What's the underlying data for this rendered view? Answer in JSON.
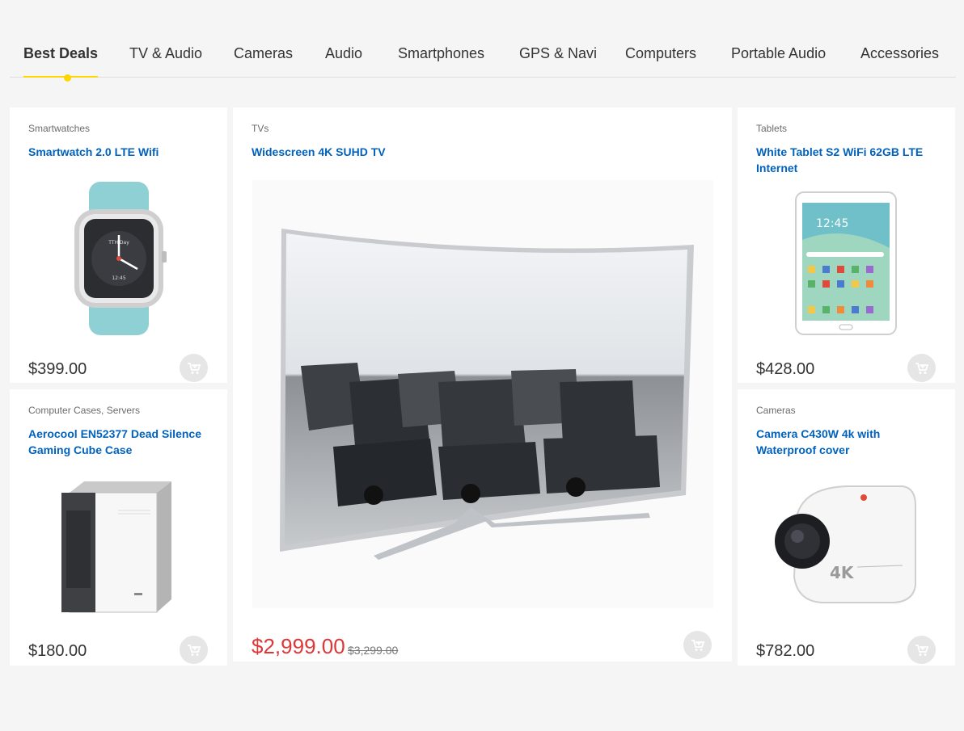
{
  "tabs": [
    "Best Deals",
    "TV & Audio",
    "Cameras",
    "Audio",
    "Smartphones",
    "GPS & Navi",
    "Computers",
    "Portable Audio",
    "Accessories"
  ],
  "active_tab": "Best Deals",
  "colors": {
    "accent": "#fed700",
    "title": "#0062bd",
    "sale": "#df3737",
    "cart_bg": "#e6e6e6"
  },
  "products": {
    "smartwatch": {
      "category": "Smartwatches",
      "title": "Smartwatch 2.0 LTE Wifi",
      "price": "$399.00",
      "icon": "add-to-cart-icon"
    },
    "tv": {
      "category": "TVs",
      "title": "Widescreen 4K SUHD TV",
      "price": "$2,999.00",
      "old_price": "$3,299.00",
      "icon": "add-to-cart-icon"
    },
    "tablet": {
      "category": "Tablets",
      "title": "White Tablet S2 WiFi 62GB LTE Internet",
      "price": "$428.00",
      "icon": "add-to-cart-icon"
    },
    "case": {
      "category": "Computer Cases, Servers",
      "title": "Aerocool EN52377 Dead Silence Gaming Cube Case",
      "price": "$180.00",
      "icon": "add-to-cart-icon"
    },
    "camera": {
      "category": "Cameras",
      "title": "Camera C430W 4k with Waterproof cover",
      "price": "$782.00",
      "icon": "add-to-cart-icon"
    }
  },
  "product_images": {
    "smartwatch": {
      "time": "12:45",
      "date": "TTH Day"
    },
    "tablet": {
      "time": "12:45"
    },
    "camera": {
      "label": "4K"
    }
  }
}
